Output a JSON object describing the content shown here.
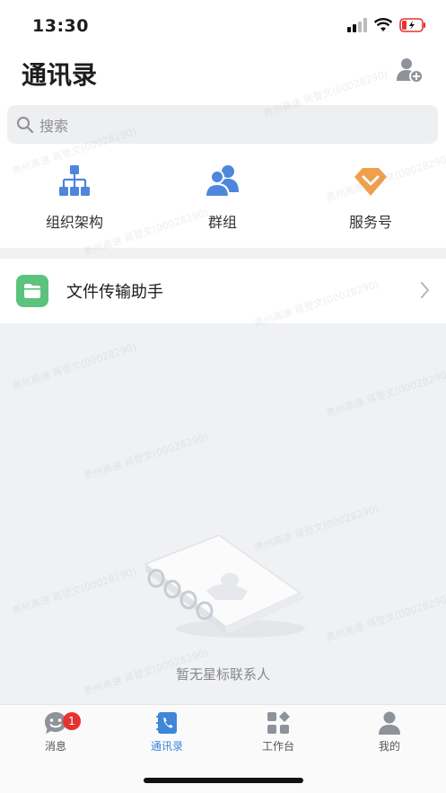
{
  "status_bar": {
    "time": "13:30"
  },
  "header": {
    "title": "通讯录"
  },
  "search": {
    "placeholder": "搜索"
  },
  "quick_entries": [
    {
      "label": "组织架构"
    },
    {
      "label": "群组"
    },
    {
      "label": "服务号"
    }
  ],
  "file_assistant": {
    "label": "文件传输助手"
  },
  "empty_state": {
    "text": "暂无星标联系人"
  },
  "tabs": [
    {
      "label": "消息",
      "badge": "1"
    },
    {
      "label": "通讯录"
    },
    {
      "label": "工作台"
    },
    {
      "label": "我的"
    }
  ],
  "watermark": "贵州高速 蒋登文(00028290)",
  "colors": {
    "accent": "#3d86d8",
    "badge": "#e5332f",
    "file_icon": "#5cc37d",
    "service": "#f0a04b"
  }
}
